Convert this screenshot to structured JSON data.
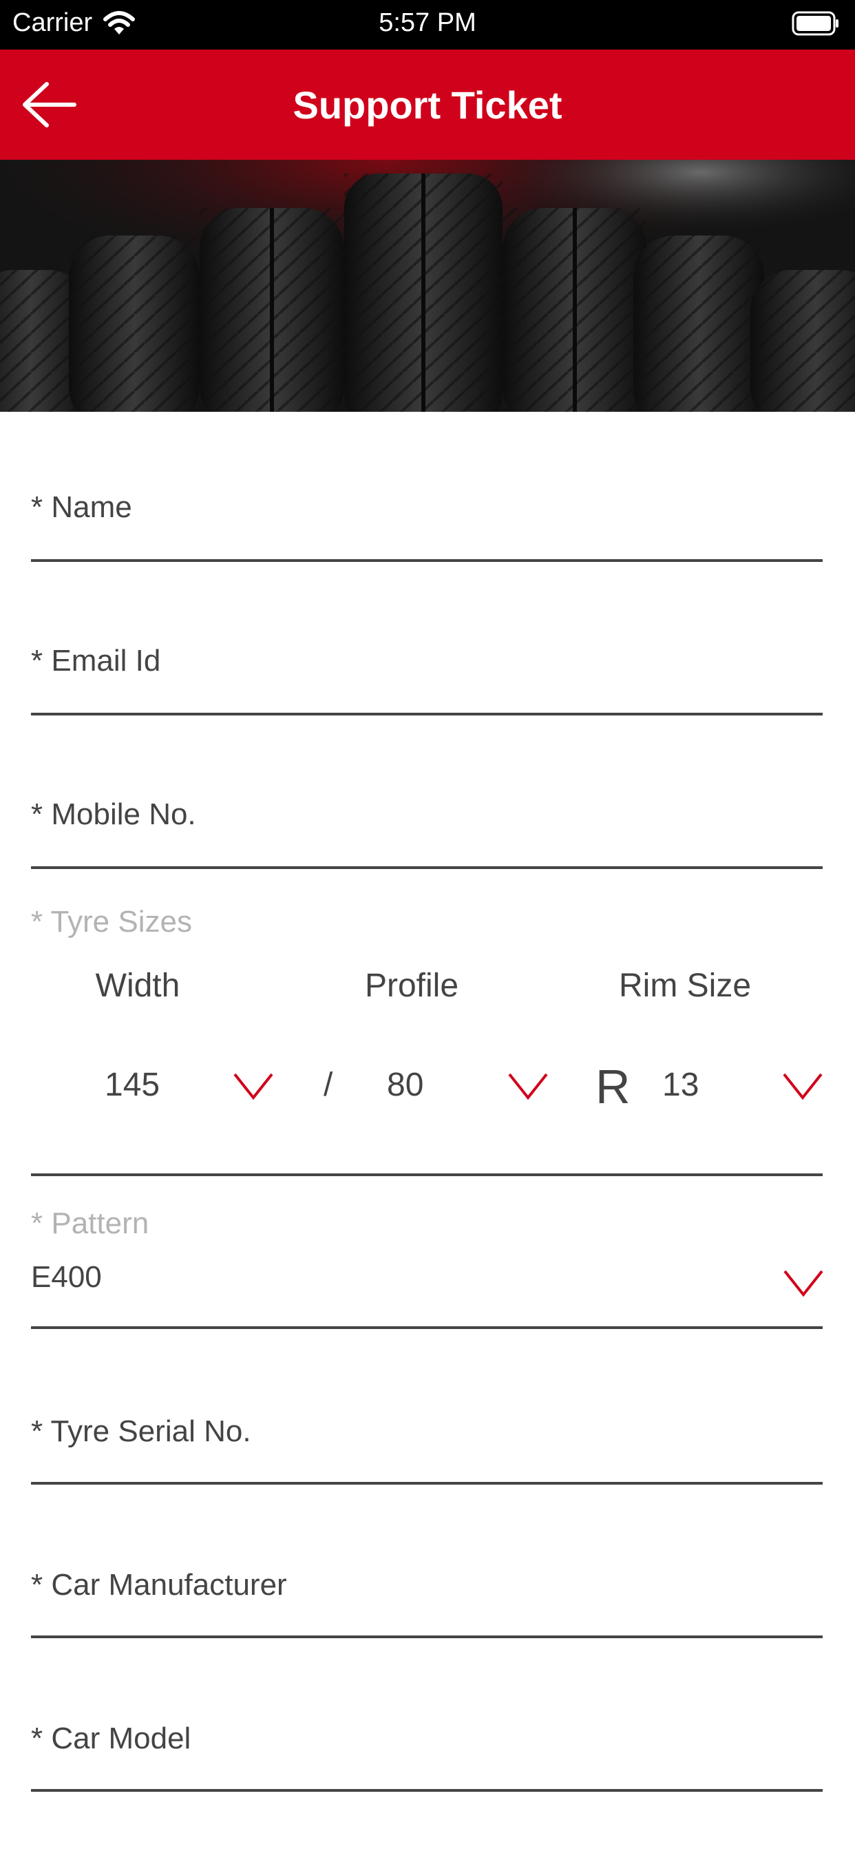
{
  "status_bar": {
    "carrier": "Carrier",
    "time": "5:57 PM"
  },
  "header": {
    "title": "Support Ticket"
  },
  "form": {
    "name_label": "* Name",
    "email_label": "* Email Id",
    "mobile_label": "* Mobile No.",
    "tyre_sizes_label": "* Tyre Sizes",
    "width_label": "Width",
    "profile_label": "Profile",
    "rim_label": "Rim Size",
    "width_value": "145",
    "separator": "/",
    "profile_value": "80",
    "rim_prefix": "R",
    "rim_value": "13",
    "pattern_label": "* Pattern",
    "pattern_value": "E400",
    "serial_label": "* Tyre Serial No.",
    "manufacturer_label": "* Car Manufacturer",
    "model_label": "* Car Model"
  },
  "colors": {
    "accent": "#d0021b",
    "status_bar": "#000000",
    "text": "#444444",
    "muted": "#b3b3b3"
  }
}
